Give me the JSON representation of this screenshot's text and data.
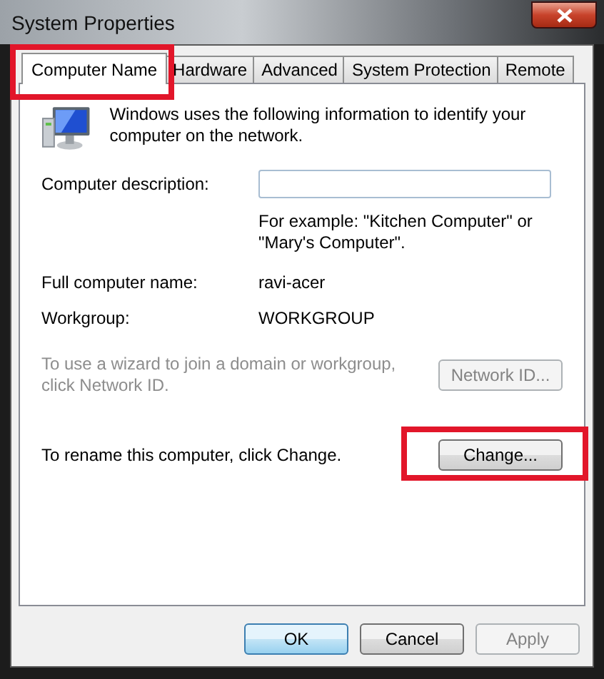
{
  "window": {
    "title": "System Properties"
  },
  "tabs": [
    {
      "label": "Computer Name",
      "selected": true,
      "highlighted": true
    },
    {
      "label": "Hardware",
      "selected": false,
      "highlighted": false
    },
    {
      "label": "Advanced",
      "selected": false,
      "highlighted": false
    },
    {
      "label": "System Protection",
      "selected": false,
      "highlighted": false
    },
    {
      "label": "Remote",
      "selected": false,
      "highlighted": false
    }
  ],
  "intro": "Windows uses the following information to identify your computer on the network.",
  "description": {
    "label": "Computer description:"
  },
  "example": "For example: \"Kitchen Computer\" or \"Mary's Computer\".",
  "info_rows": [
    {
      "label": "Full computer name:",
      "value": "ravi-acer"
    },
    {
      "label": "Workgroup:",
      "value": "WORKGROUP"
    }
  ],
  "actions": [
    {
      "text": "To use a wizard to join a domain or workgroup, click Network ID.",
      "button": "Network ID...",
      "disabled": true,
      "highlighted": false
    },
    {
      "text": "To rename this computer, click Change.",
      "button": "Change...",
      "disabled": false,
      "highlighted": true
    }
  ],
  "buttons": [
    {
      "label": "OK",
      "kind": "default",
      "disabled": false
    },
    {
      "label": "Cancel",
      "kind": "normal",
      "disabled": false
    },
    {
      "label": "Apply",
      "kind": "normal",
      "disabled": true
    }
  ]
}
